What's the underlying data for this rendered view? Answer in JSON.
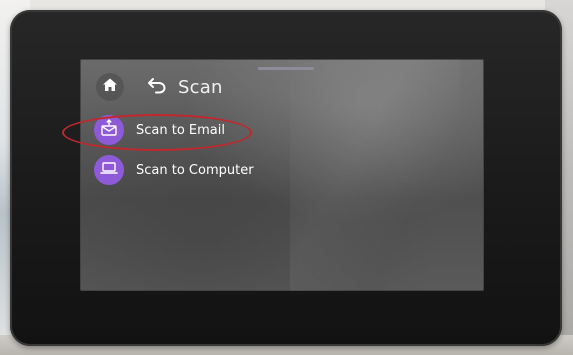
{
  "header": {
    "title": "Scan",
    "home_icon": "home-icon",
    "back_icon": "back-arrow-icon"
  },
  "menu": {
    "items": [
      {
        "label": "Scan to Email",
        "icon": "envelope-icon",
        "highlighted": true
      },
      {
        "label": "Scan to Computer",
        "icon": "laptop-icon",
        "highlighted": false
      }
    ]
  },
  "colors": {
    "accent": "#8f5ad8",
    "highlight_ring": "#c2272d",
    "screen_bg": "#5c5c5c",
    "bezel": "#1b1b1b"
  }
}
